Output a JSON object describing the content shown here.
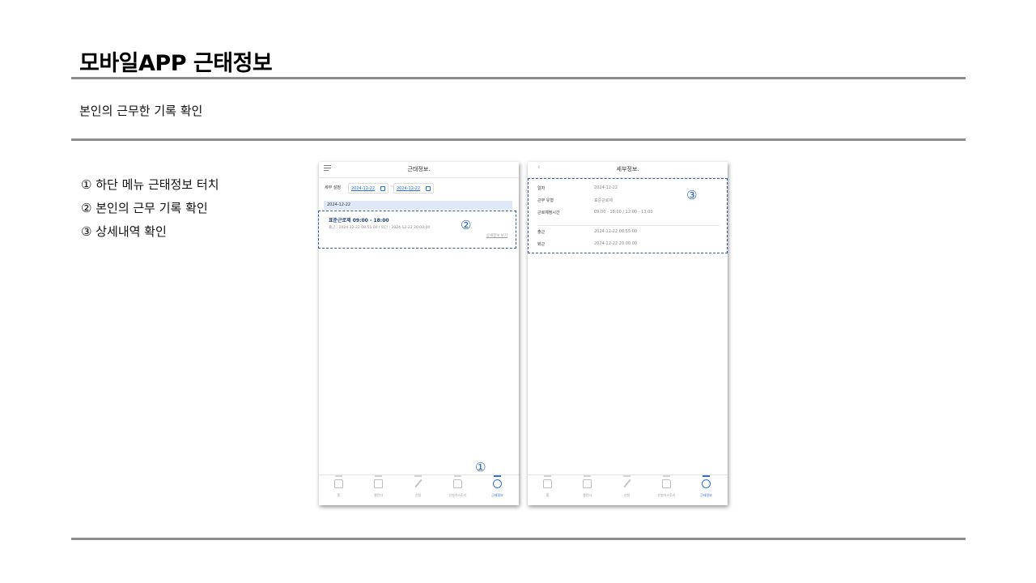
{
  "slide": {
    "title": "모바일APP 근태정보",
    "subtitle": "본인의 근무한 기록 확인",
    "steps": [
      "① 하단 메뉴 근태정보 터치",
      "② 본인의 근무 기록 확인",
      "③ 상세내역 확인"
    ],
    "markers": [
      "①",
      "②",
      "③"
    ]
  },
  "phone1": {
    "header_title": "근태정보",
    "filter_label": "세부 설정",
    "date_from": "2024-12-22",
    "date_sep": "~",
    "date_to": "2024-12-22",
    "date_group": "2024-12-22",
    "record": {
      "title": "표준근로제 09:00 - 18:00",
      "subtitle": "출근 : 2024-12-22 08:55:00 / 퇴근 : 2024-12-22 20:00:00",
      "link": "상세정보 보기"
    }
  },
  "phone2": {
    "header_title": "세부정보",
    "back_icon": "‹",
    "rows": [
      {
        "key": "일자",
        "value": "2024-12-22"
      },
      {
        "key": "근무 유형",
        "value": "표준근로제"
      },
      {
        "key": "근로예정시간",
        "value": "09:00 - 18:00 / 12:00 - 13:00"
      },
      {
        "key": "출근",
        "value": "2024-12-22 08:55:00"
      },
      {
        "key": "퇴근",
        "value": "2024-12-22 20:00:00"
      }
    ]
  },
  "tabbar": {
    "items": [
      {
        "label": "홈",
        "icon": "home-icon"
      },
      {
        "label": "캘린더",
        "icon": "calendar-icon"
      },
      {
        "label": "신청",
        "icon": "pen-icon"
      },
      {
        "label": "신청히스토리",
        "icon": "document-icon"
      },
      {
        "label": "근태정보",
        "icon": "clock-icon"
      }
    ],
    "active_index": 4,
    "active_color": "#2a6fdb"
  }
}
